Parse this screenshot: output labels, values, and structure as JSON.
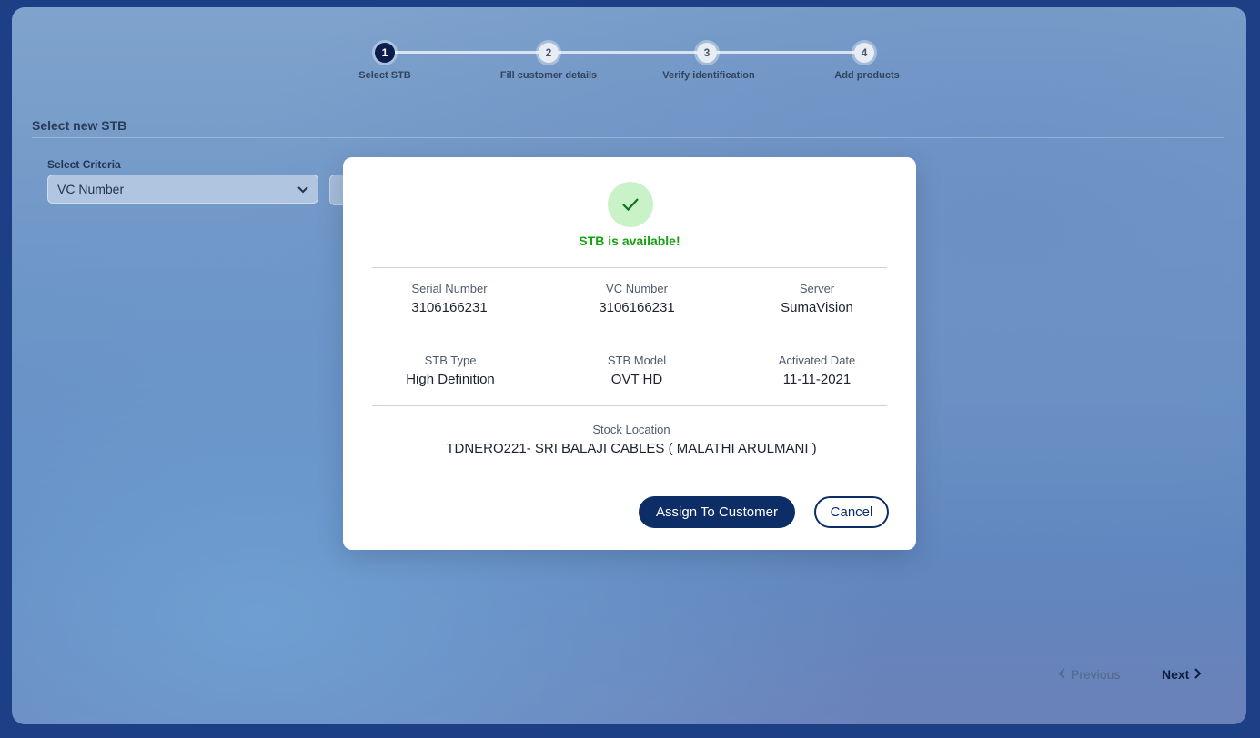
{
  "stepper": {
    "steps": [
      {
        "number": "1",
        "label": "Select STB"
      },
      {
        "number": "2",
        "label": "Fill customer details"
      },
      {
        "number": "3",
        "label": "Verify identification"
      },
      {
        "number": "4",
        "label": "Add products"
      }
    ],
    "active_step": 1
  },
  "page": {
    "section_title": "Select new STB",
    "criteria_label": "Select Criteria",
    "criteria_value": "VC Number",
    "previous_label": "Previous",
    "next_label": "Next"
  },
  "modal": {
    "status_text": "STB is available!",
    "fields": {
      "serial_number": {
        "label": "Serial Number",
        "value": "3106166231"
      },
      "vc_number": {
        "label": "VC Number",
        "value": "3106166231"
      },
      "server": {
        "label": "Server",
        "value": "SumaVision"
      },
      "stb_type": {
        "label": "STB Type",
        "value": "High Definition"
      },
      "stb_model": {
        "label": "STB Model",
        "value": "OVT HD"
      },
      "activated_date": {
        "label": "Activated Date",
        "value": "11-11-2021"
      },
      "stock_location": {
        "label": "Stock Location",
        "value": "TDNERO221- SRI BALAJI CABLES ( MALATHI ARULMANI )"
      }
    },
    "assign_button": "Assign To Customer",
    "cancel_button": "Cancel"
  },
  "icons": {
    "status": "check-icon",
    "criteria_dropdown": "chevron-down-icon",
    "previous": "chevron-left-icon",
    "next": "chevron-right-icon"
  },
  "colors": {
    "primary": "#0c2d66",
    "success": "#14a10f",
    "success_bg": "#c9f2c9",
    "active_step": "#0d1c4a"
  }
}
